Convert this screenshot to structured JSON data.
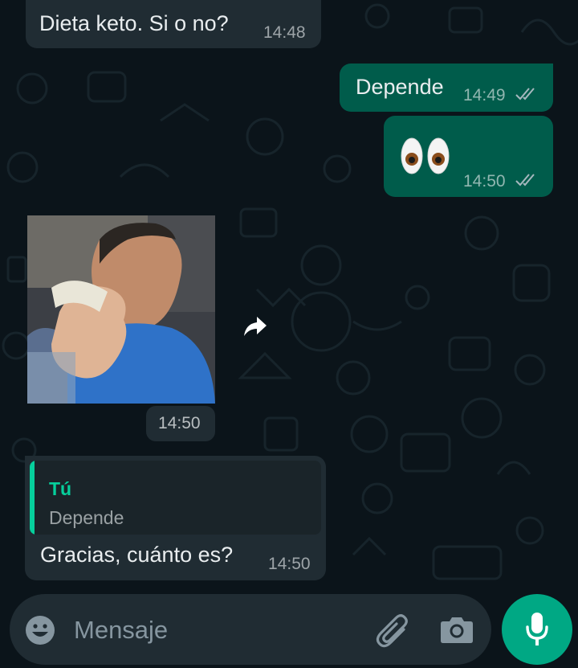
{
  "messages": [
    {
      "text": "Dieta keto. Si o no?",
      "time": "14:48",
      "direction": "incoming"
    },
    {
      "text": "Depende",
      "time": "14:49",
      "direction": "outgoing",
      "status": "read"
    },
    {
      "text": "👀",
      "time": "14:50",
      "direction": "outgoing",
      "status": "read"
    },
    {
      "type": "image",
      "time": "14:50",
      "direction": "incoming",
      "forwardable": true
    },
    {
      "reply_to": {
        "author": "Tú",
        "text": "Depende"
      },
      "text": "Gracias, cuánto es?",
      "time": "14:50",
      "direction": "incoming"
    }
  ],
  "composer": {
    "placeholder": "Mensaje"
  },
  "colors": {
    "background": "#0b141a",
    "incoming_bubble": "#202c33",
    "outgoing_bubble": "#005c4b",
    "accent": "#00a884",
    "reply_author": "#06cf9c"
  },
  "icons": [
    "read-receipt-icon",
    "forward-icon",
    "emoji-icon",
    "attach-icon",
    "camera-icon",
    "mic-icon"
  ]
}
